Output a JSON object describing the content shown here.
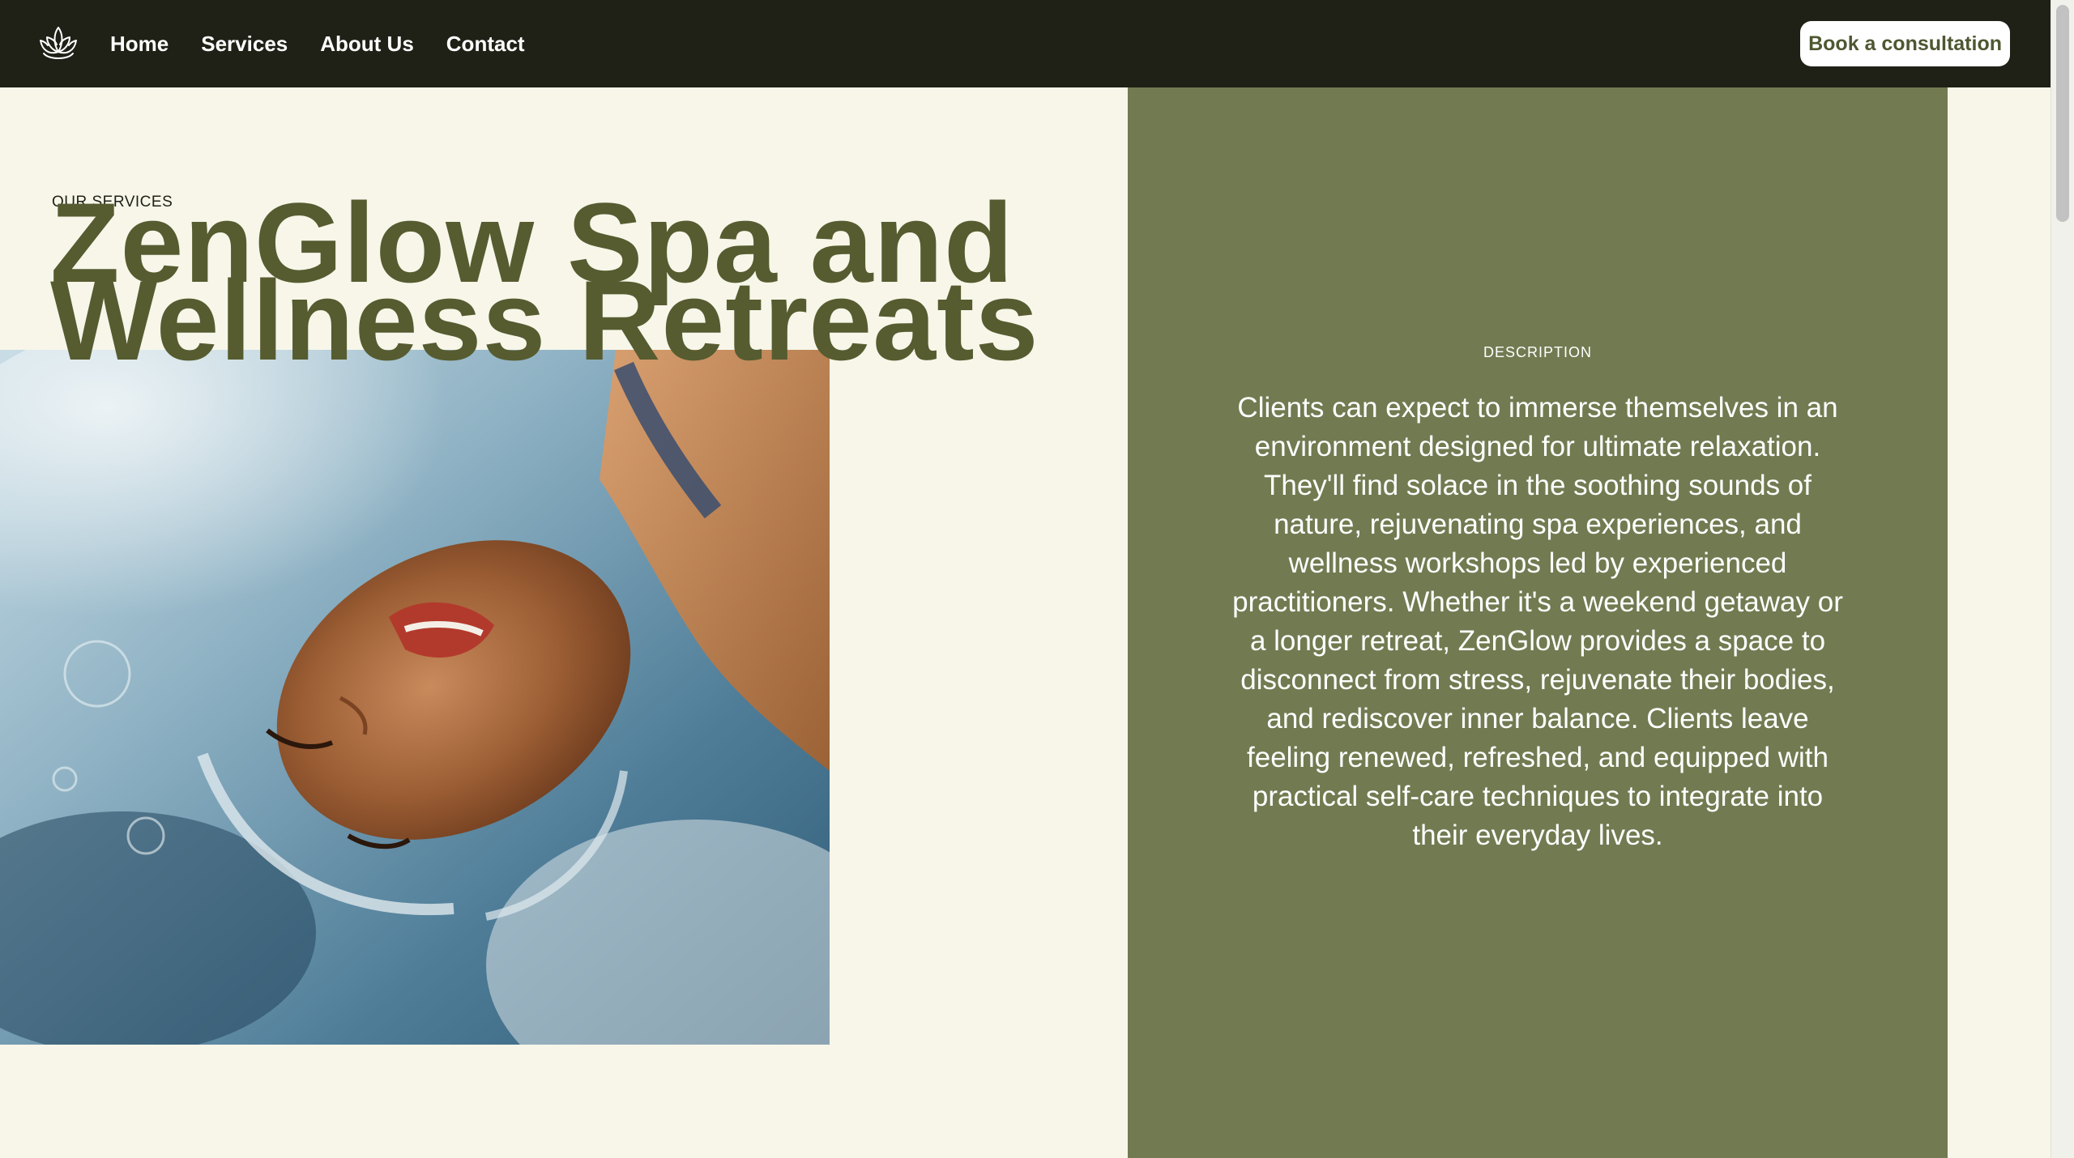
{
  "navbar": {
    "logo_icon": "lotus-icon",
    "links": [
      {
        "label": "Home"
      },
      {
        "label": "Services"
      },
      {
        "label": "About Us"
      },
      {
        "label": "Contact"
      }
    ],
    "cta_label": "Book a consultation"
  },
  "hero": {
    "eyebrow": "OUR SERVICES",
    "title_line1": "ZenGlow Spa and",
    "title_line2": "Wellness Retreats",
    "photo_subject": "woman-floating-in-water-image"
  },
  "description": {
    "label": "DESCRIPTION",
    "text": "Clients can expect to immerse themselves in an environment designed for ultimate relaxation. They'll find solace in the soothing sounds of nature, rejuvenating spa experiences, and wellness workshops led by experienced practitioners. Whether it's a weekend getaway or a longer retreat, ZenGlow provides a space to disconnect from stress, rejuvenate their bodies, and rediscover inner balance. Clients leave feeling renewed, refreshed, and equipped with practical self-care techniques to integrate into their everyday lives."
  },
  "colors": {
    "navbar_bg": "#1f2117",
    "page_bg": "#f7f6e9",
    "accent_olive": "#565c30",
    "panel_bg": "#727a51",
    "cta_text": "#4e5731"
  }
}
